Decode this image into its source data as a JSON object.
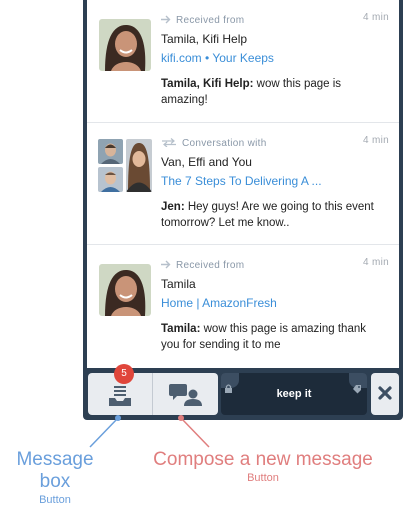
{
  "feed": [
    {
      "time": "4 min",
      "kind": "Received from",
      "who": "Tamila, Kifi Help",
      "link": "kifi.com • Your Keeps",
      "sender": "Tamila, Kifi Help:",
      "text": " wow this page is amazing!"
    },
    {
      "time": "4 min",
      "kind": "Conversation with",
      "who": "Van, Effi and You",
      "link": "The 7 Steps To Delivering A ...",
      "sender": "Jen:",
      "text": " Hey guys! Are we going to this event tomorrow? Let me know.."
    },
    {
      "time": "4 min",
      "kind": "Received from",
      "who": "Tamila",
      "link": "Home | AmazonFresh",
      "sender": "Tamila:",
      "text": " wow this page is amazing thank you for sending it to me"
    }
  ],
  "toolbar": {
    "badge_count": "5",
    "tag_label": "keep it",
    "inbox_icon": "inbox-tray-icon",
    "compose_icon": "compose-people-icon",
    "close_icon": "close-icon"
  },
  "callouts": {
    "message_box": {
      "title": "Message box",
      "subtitle": "Button"
    },
    "compose": {
      "title": "Compose a new message",
      "subtitle": "Button"
    }
  },
  "colors": {
    "panel": "#2d3f52",
    "link": "#3a8ed8",
    "badge": "#e0463b",
    "callout_blue": "#6a9fdc",
    "callout_red": "#e07e7e"
  }
}
